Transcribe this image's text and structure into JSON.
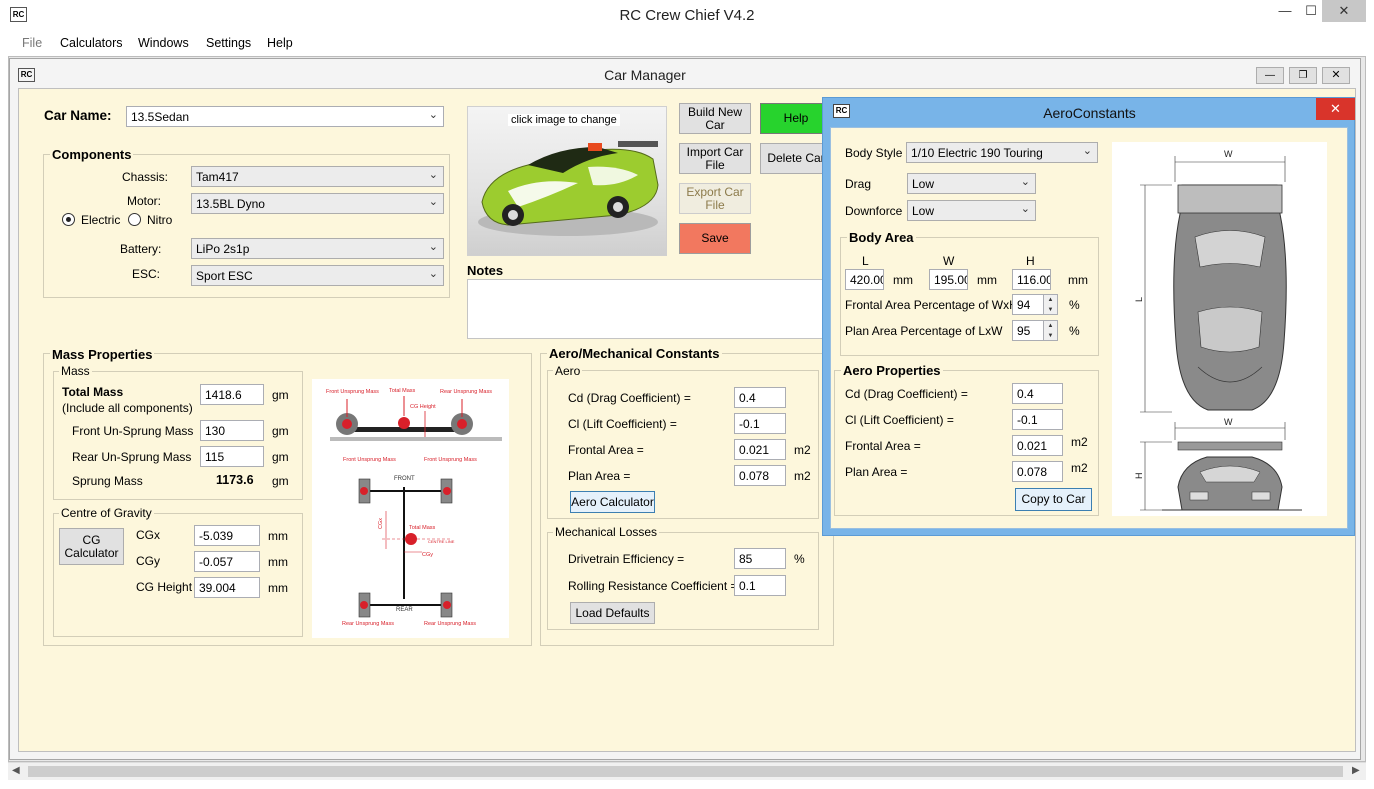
{
  "app": {
    "title": "RC Crew Chief V4.2",
    "menu": [
      "File",
      "Calculators",
      "Windows",
      "Settings",
      "Help"
    ]
  },
  "car_manager": {
    "title": "Car Manager",
    "car_name_label": "Car Name:",
    "car_name_value": "13.5Sedan",
    "components": {
      "title": "Components",
      "chassis_label": "Chassis:",
      "chassis_value": "Tam417",
      "motor_label": "Motor:",
      "motor_value": "13.5BL Dyno",
      "electric_label": "Electric",
      "nitro_label": "Nitro",
      "battery_label": "Battery:",
      "battery_value": "LiPo 2s1p",
      "esc_label": "ESC:",
      "esc_value": "Sport ESC"
    },
    "image_caption": "click image to change",
    "buttons": {
      "build_new": "Build New Car",
      "import": "Import Car File",
      "export": "Export Car File",
      "save": "Save",
      "help": "Help",
      "delete": "Delete Car"
    },
    "notes_label": "Notes",
    "mass": {
      "title": "Mass Properties",
      "group": "Mass",
      "total_label": "Total Mass",
      "total_sub": "(Include all components)",
      "total_value": "1418.6",
      "front_label": "Front Un-Sprung Mass",
      "front_value": "130",
      "rear_label": "Rear Un-Sprung Mass",
      "rear_value": "115",
      "sprung_label": "Sprung Mass",
      "sprung_value": "1173.6",
      "unit": "gm"
    },
    "cg": {
      "group": "Centre of Gravity",
      "button": "CG Calculator",
      "cgx_label": "CGx",
      "cgx_value": "-5.039",
      "cgy_label": "CGy",
      "cgy_value": "-0.057",
      "cgh_label": "CG Height",
      "cgh_value": "39.004",
      "unit": "mm"
    },
    "diagram": {
      "front_unsprung": "Front Unsprung Mass",
      "total_mass": "Total Mass",
      "rear_unsprung": "Rear Unsprung Mass",
      "cg_height": "CG Height",
      "front": "FRONT",
      "rear": "REAR",
      "cgx": "CGx",
      "cgy": "CGy",
      "centre_line": "CENTRE LINE"
    },
    "aero_mech": {
      "title": "Aero/Mechanical Constants",
      "aero_group": "Aero",
      "cd_label": "Cd (Drag Coefficient) =",
      "cd_value": "0.4",
      "cl_label": "Cl (Lift Coefficient) =",
      "cl_value": "-0.1",
      "frontal_label": "Frontal Area =",
      "frontal_value": "0.021",
      "plan_label": "Plan Area =",
      "plan_value": "0.078",
      "unit_m2": "m2",
      "aero_calc_button": "Aero Calculator",
      "mech_group": "Mechanical Losses",
      "drivetrain_label": "Drivetrain Efficiency =",
      "drivetrain_value": "85",
      "pct": "%",
      "rolling_label": "Rolling Resistance Coefficient =",
      "rolling_value": "0.1",
      "load_defaults_button": "Load Defaults"
    }
  },
  "aero_constants": {
    "title": "AeroConstants",
    "body_style_label": "Body Style",
    "body_style_value": "1/10 Electric 190 Touring",
    "drag_label": "Drag",
    "drag_value": "Low",
    "downforce_label": "Downforce",
    "downforce_value": "Low",
    "body_area_title": "Body Area",
    "l_label": "L",
    "w_label": "W",
    "h_label": "H",
    "l_value": "420.00",
    "w_value": "195.00",
    "h_value": "116.00",
    "mm": "mm",
    "frontal_pct_label": "Frontal Area Percentage of  WxH",
    "frontal_pct_value": "94",
    "plan_pct_label": "Plan Area Percentage of  LxW",
    "plan_pct_value": "95",
    "pct": "%",
    "aero_props_title": "Aero Properties",
    "cd_label": "Cd (Drag Coefficient) =",
    "cd_value": "0.4",
    "cl_label": "Cl (Lift Coefficient) =",
    "cl_value": "-0.1",
    "frontal_label": "Frontal Area =",
    "frontal_value": "0.021",
    "plan_label": "Plan Area =",
    "plan_value": "0.078",
    "m2": "m2",
    "copy_button": "Copy to Car",
    "dim_w": "W",
    "dim_l": "L",
    "dim_h": "H"
  }
}
